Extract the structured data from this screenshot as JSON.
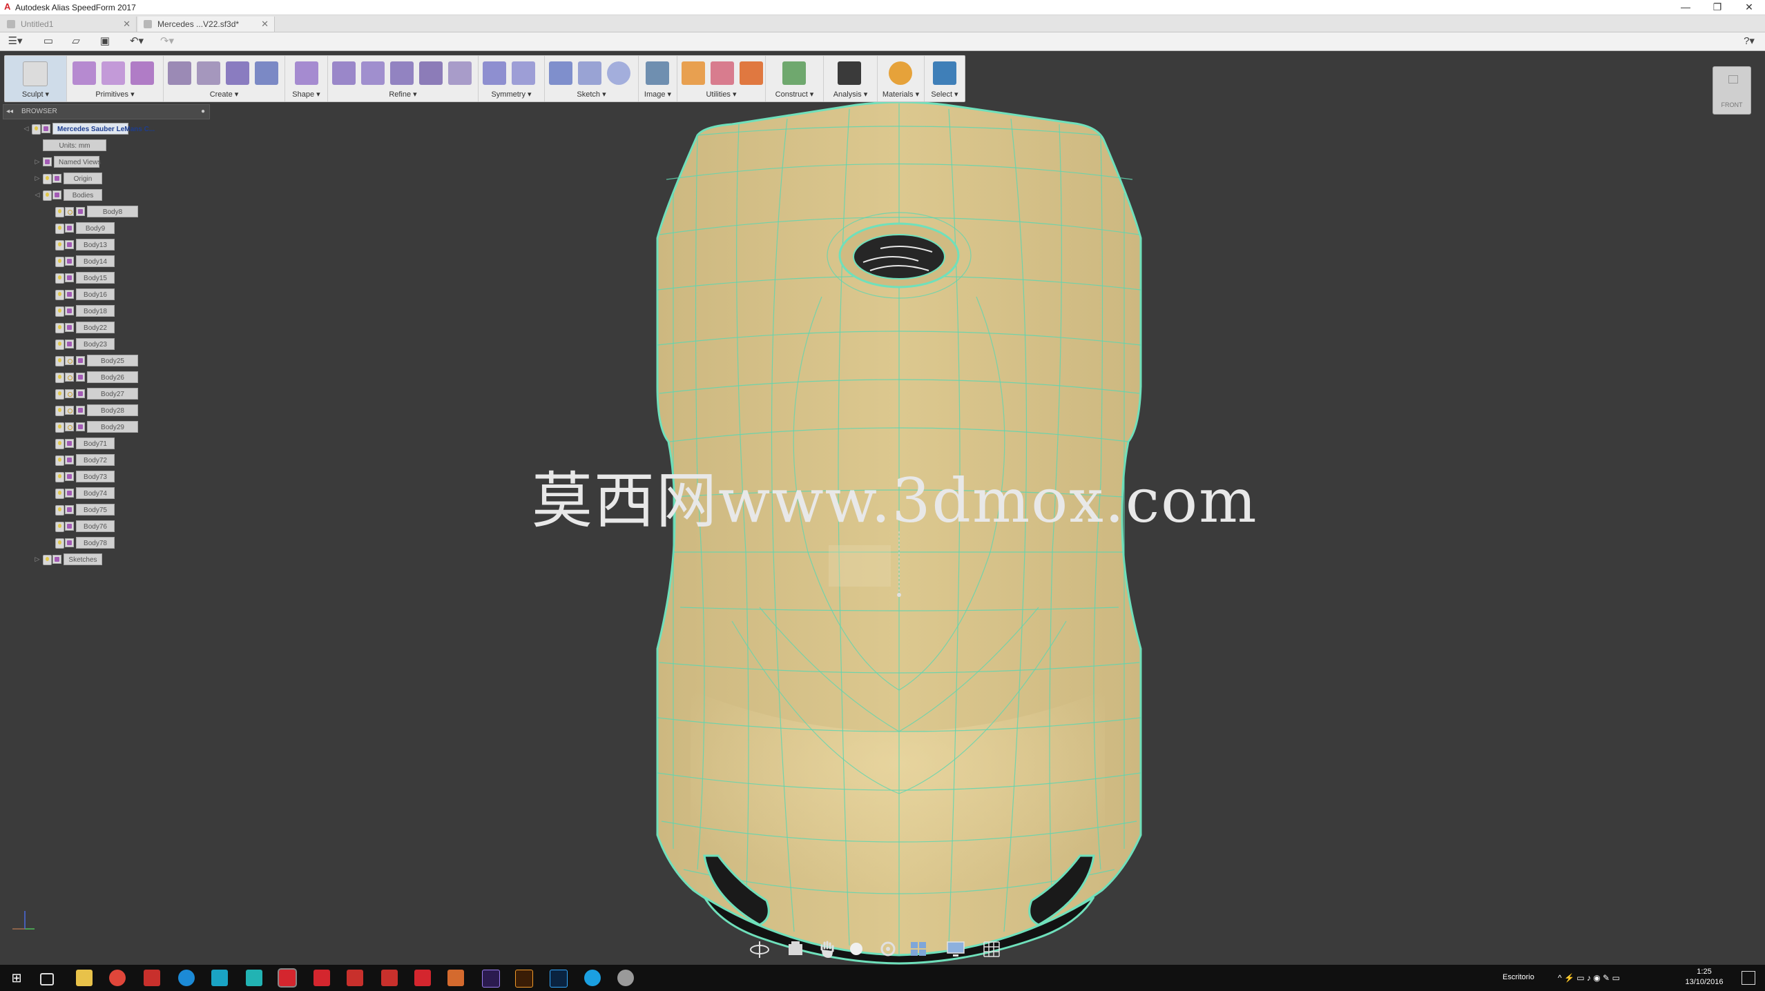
{
  "app": {
    "title": "Autodesk Alias SpeedForm 2017"
  },
  "tabs": [
    {
      "label": "Untitled1",
      "active": false
    },
    {
      "label": "Mercedes ...V22.sf3d*",
      "active": true
    }
  ],
  "window_controls": {
    "minimize": "—",
    "restore": "❐",
    "close": "✕"
  },
  "toolbar": {
    "groups": [
      {
        "label": "Sculpt ▾"
      },
      {
        "label": "Primitives ▾"
      },
      {
        "label": "Create ▾"
      },
      {
        "label": "Shape ▾"
      },
      {
        "label": "Refine ▾"
      },
      {
        "label": "Symmetry ▾"
      },
      {
        "label": "Sketch ▾"
      },
      {
        "label": "Image ▾"
      },
      {
        "label": "Utilities ▾"
      },
      {
        "label": "Construct ▾"
      },
      {
        "label": "Analysis ▾"
      },
      {
        "label": "Materials ▾"
      },
      {
        "label": "Select ▾"
      }
    ]
  },
  "browser": {
    "header": "BROWSER",
    "root": "Mercedes Sauber LeMans C...",
    "units": "Units: mm",
    "named_views": "Named Views",
    "origin": "Origin",
    "bodies_folder": "Bodies",
    "bodies": [
      "Body8",
      "Body9",
      "Body13",
      "Body14",
      "Body15",
      "Body16",
      "Body18",
      "Body22",
      "Body23",
      "Body25",
      "Body26",
      "Body27",
      "Body28",
      "Body29",
      "Body71",
      "Body72",
      "Body73",
      "Body74",
      "Body75",
      "Body76",
      "Body78"
    ],
    "sketches": "Sketches"
  },
  "viewcube": {
    "face": "FRONT"
  },
  "watermark": "莫西网www.3dmox.com",
  "taskbar": {
    "language": "Escritorio",
    "time": "1:25",
    "date": "13/10/2016"
  },
  "colors": {
    "surface": "#d8c48a",
    "wire": "#5fd6b0",
    "viewport": "#3b3b3b"
  }
}
